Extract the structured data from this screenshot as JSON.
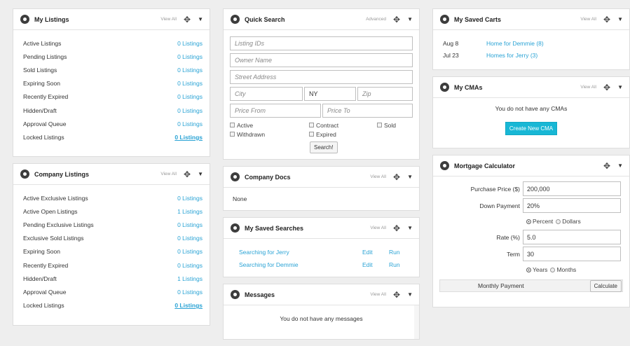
{
  "my_listings": {
    "title": "My Listings",
    "view_all": "View All",
    "rows": [
      {
        "label": "Active Listings",
        "value": "0 Listings"
      },
      {
        "label": "Pending Listings",
        "value": "0 Listings"
      },
      {
        "label": "Sold Listings",
        "value": "0 Listings"
      },
      {
        "label": "Expiring Soon",
        "value": "0 Listings"
      },
      {
        "label": "Recently Expired",
        "value": "0 Listings"
      },
      {
        "label": "Hidden/Draft",
        "value": "0 Listings"
      },
      {
        "label": "Approval Queue",
        "value": "0 Listings"
      },
      {
        "label": "Locked Listings",
        "value": "0 Listings"
      }
    ]
  },
  "company_listings": {
    "title": "Company Listings",
    "view_all": "View All",
    "rows": [
      {
        "label": "Active Exclusive Listings",
        "value": "0 Listings"
      },
      {
        "label": "Active Open Listings",
        "value": "1 Listings"
      },
      {
        "label": "Pending Exclusive Listings",
        "value": "0 Listings"
      },
      {
        "label": "Exclusive Sold Listings",
        "value": "0 Listings"
      },
      {
        "label": "Expiring Soon",
        "value": "0 Listings"
      },
      {
        "label": "Recently Expired",
        "value": "0 Listings"
      },
      {
        "label": "Hidden/Draft",
        "value": "1 Listings"
      },
      {
        "label": "Approval Queue",
        "value": "0 Listings"
      },
      {
        "label": "Locked Listings",
        "value": "0 Listings"
      }
    ]
  },
  "quick_search": {
    "title": "Quick Search",
    "advanced": "Advanced",
    "listing_ids_placeholder": "Listing IDs",
    "owner_name_placeholder": "Owner Name",
    "street_address_placeholder": "Street Address",
    "city_placeholder": "City",
    "state_value": "NY",
    "zip_placeholder": "Zip",
    "price_from_placeholder": "Price From",
    "price_to_placeholder": "Price To",
    "checkboxes": [
      "Active",
      "Contract",
      "Sold",
      "Withdrawn",
      "Expired"
    ],
    "search_button": "Search!"
  },
  "company_docs": {
    "title": "Company Docs",
    "view_all": "View All",
    "empty": "None"
  },
  "saved_searches": {
    "title": "My Saved Searches",
    "view_all": "View All",
    "items": [
      {
        "name": "Searching for Jerry",
        "edit": "Edit",
        "run": "Run"
      },
      {
        "name": "Searching for Demmie",
        "edit": "Edit",
        "run": "Run"
      }
    ]
  },
  "messages": {
    "title": "Messages",
    "view_all": "View All",
    "empty": "You do not have any messages"
  },
  "saved_carts": {
    "title": "My Saved Carts",
    "view_all": "View All",
    "items": [
      {
        "date": "Aug 8",
        "name": "Home for Demmie (8)"
      },
      {
        "date": "Jul 23",
        "name": "Homes for Jerry (3)"
      }
    ]
  },
  "cmas": {
    "title": "My CMAs",
    "view_all": "View All",
    "empty": "You do not have any CMAs",
    "create_button": "Create New CMA"
  },
  "mortgage": {
    "title": "Mortgage Calculator",
    "purchase_price_label": "Purchase Price ($)",
    "purchase_price_value": "200,000",
    "down_payment_label": "Down Payment",
    "down_payment_value": "20%",
    "percent_label": "Percent",
    "dollars_label": "Dollars",
    "rate_label": "Rate (%)",
    "rate_value": "5.0",
    "term_label": "Term",
    "term_value": "30",
    "years_label": "Years",
    "months_label": "Months",
    "monthly_payment_label": "Monthly Payment",
    "calculate_button": "Calculate"
  }
}
